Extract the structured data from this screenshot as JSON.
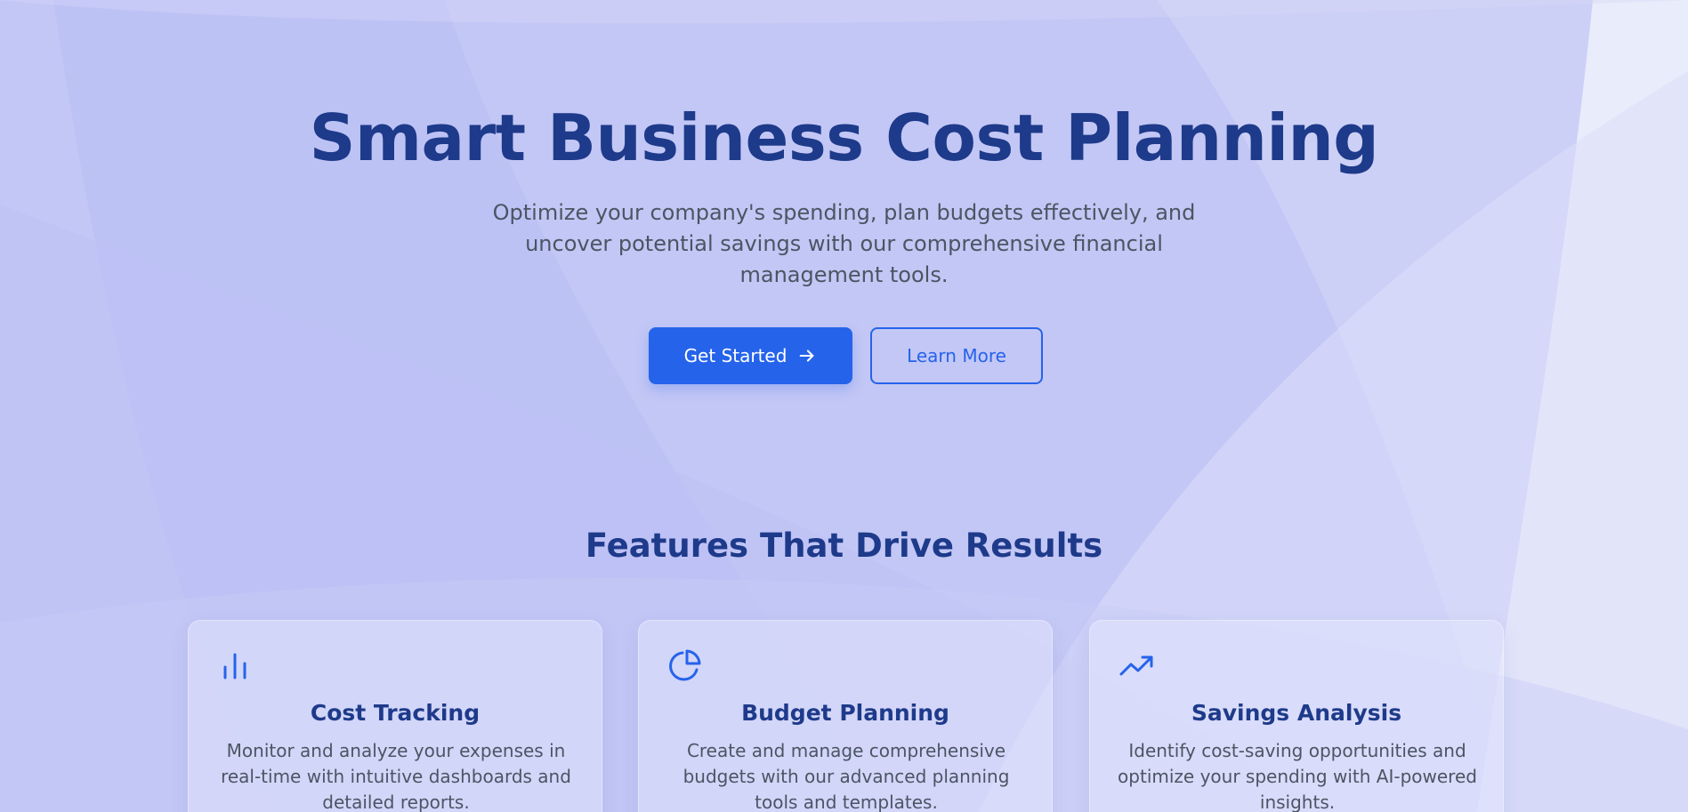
{
  "hero": {
    "title": "Smart Business Cost Planning",
    "subtitle": "Optimize your company's spending, plan budgets effectively, and uncover potential savings with our comprehensive financial management tools.",
    "primary_button": "Get Started",
    "secondary_button": "Learn More"
  },
  "features": {
    "title": "Features That Drive Results",
    "cards": [
      {
        "icon": "bar-chart-icon",
        "title": "Cost Tracking",
        "description": "Monitor and analyze your expenses in real-time with intuitive dashboards and detailed reports."
      },
      {
        "icon": "pie-chart-icon",
        "title": "Budget Planning",
        "description": "Create and manage comprehensive budgets with our advanced planning tools and templates."
      },
      {
        "icon": "trending-up-icon",
        "title": "Savings Analysis",
        "description": "Identify cost-saving opportunities and optimize your spending with AI-powered insights."
      }
    ]
  },
  "colors": {
    "background": "#c3c7f5",
    "primary": "#2563eb",
    "heading": "#1e3a8a",
    "body_text": "#4b5563"
  }
}
